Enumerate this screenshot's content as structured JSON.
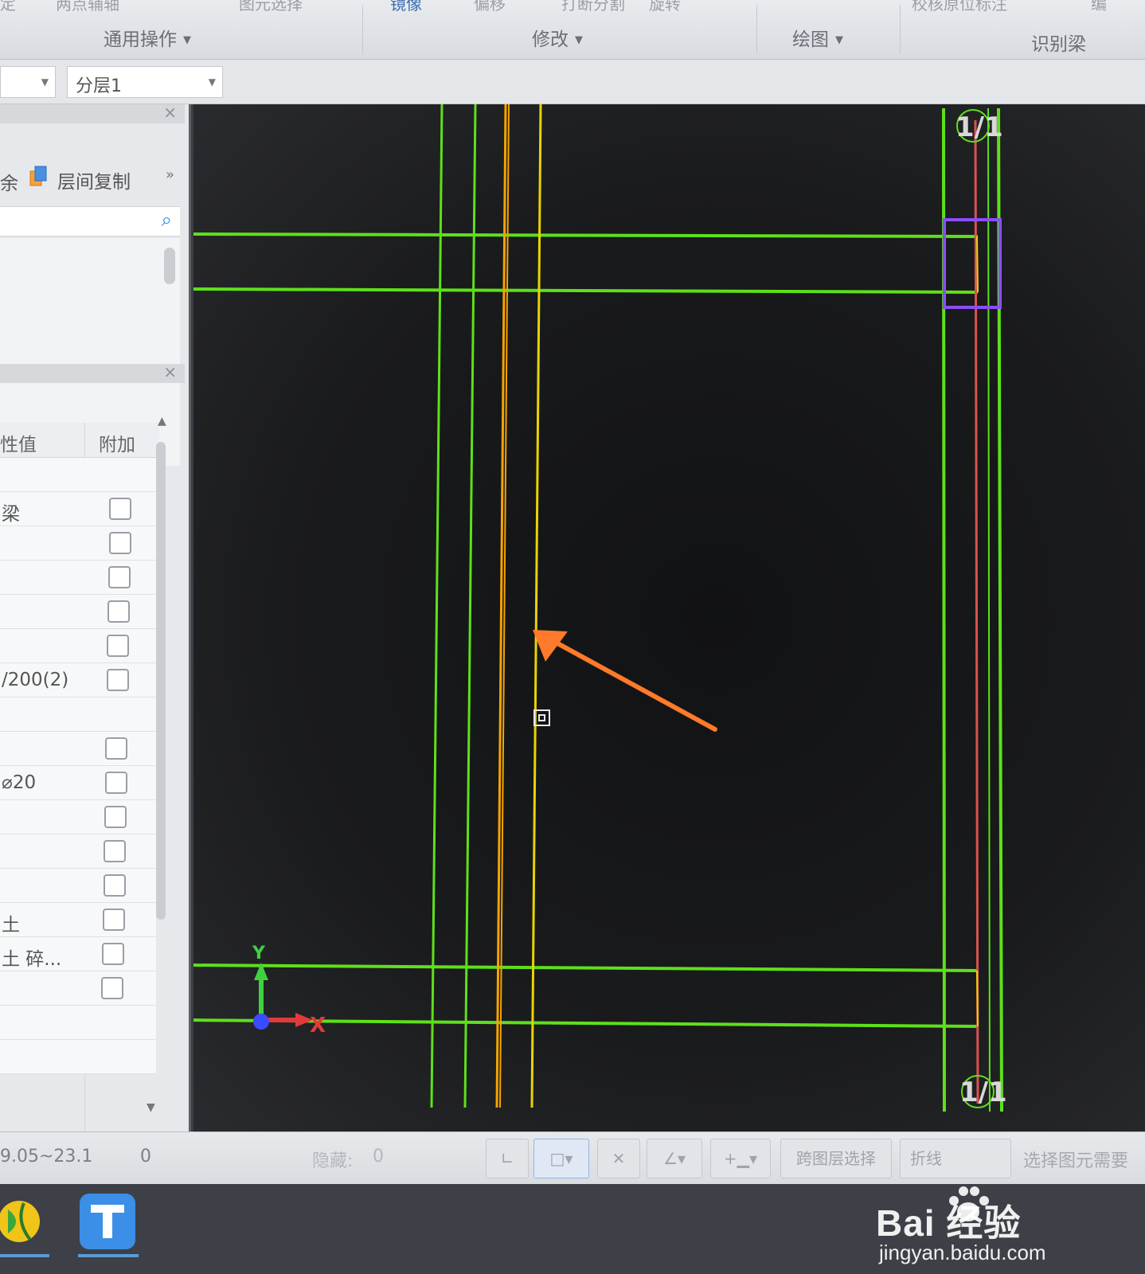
{
  "ribbon": {
    "top_left_fragment": "定",
    "top_items": [
      "两点辅轴",
      "图元选择",
      "镜像",
      "偏移",
      "打断分割",
      "旋转",
      "校核原位标注",
      "编"
    ],
    "groups": [
      "通用操作",
      "修改",
      "绘图",
      "识别梁"
    ]
  },
  "layer_bar": {
    "left_combo_value": "",
    "layer_combo_value": "分层1"
  },
  "left_panel": {
    "toolbar_fragment": "余",
    "layer_copy_label": "层间复制",
    "more_glyph": "»",
    "prop_header": {
      "value_col": "性值",
      "attach_col": "附加"
    },
    "prop_rows": [
      {
        "value": "",
        "checkbox": false
      },
      {
        "value": "梁",
        "checkbox": true
      },
      {
        "value": "",
        "checkbox": true
      },
      {
        "value": "",
        "checkbox": true
      },
      {
        "value": "",
        "checkbox": true
      },
      {
        "value": "",
        "checkbox": true
      },
      {
        "value": "/200(2)",
        "checkbox": true
      },
      {
        "value": "",
        "checkbox": false
      },
      {
        "value": "",
        "checkbox": true
      },
      {
        "value": "⌀20",
        "checkbox": true
      },
      {
        "value": "",
        "checkbox": true
      },
      {
        "value": "",
        "checkbox": true
      },
      {
        "value": "",
        "checkbox": true
      },
      {
        "value": "土",
        "checkbox": true
      },
      {
        "value": "土 碎...",
        "checkbox": true
      },
      {
        "value": "",
        "checkbox": true
      },
      {
        "value": "",
        "checkbox": false
      },
      {
        "value": "",
        "checkbox": false
      }
    ]
  },
  "canvas": {
    "axis_label_top": "1/1",
    "axis_label_bottom": "1/1",
    "ucs_x": "X",
    "ucs_y": "Y",
    "colors": {
      "green": "#5ee01a",
      "orange": "#f5a400",
      "yellow": "#e8d400",
      "red": "#d9534f",
      "purple": "#8a4dff",
      "arrow": "#ff7a2a"
    }
  },
  "status_bar": {
    "elevation": "9.05~23.1",
    "count": "0",
    "hidden_label": "隐藏:",
    "hidden_count": "0",
    "cross_layer_select": "跨图层选择",
    "polyline_select": "折线",
    "hint": "选择图元需要"
  },
  "watermark": {
    "brand": "Bai 经验",
    "url": "jingyan.baidu.com"
  }
}
